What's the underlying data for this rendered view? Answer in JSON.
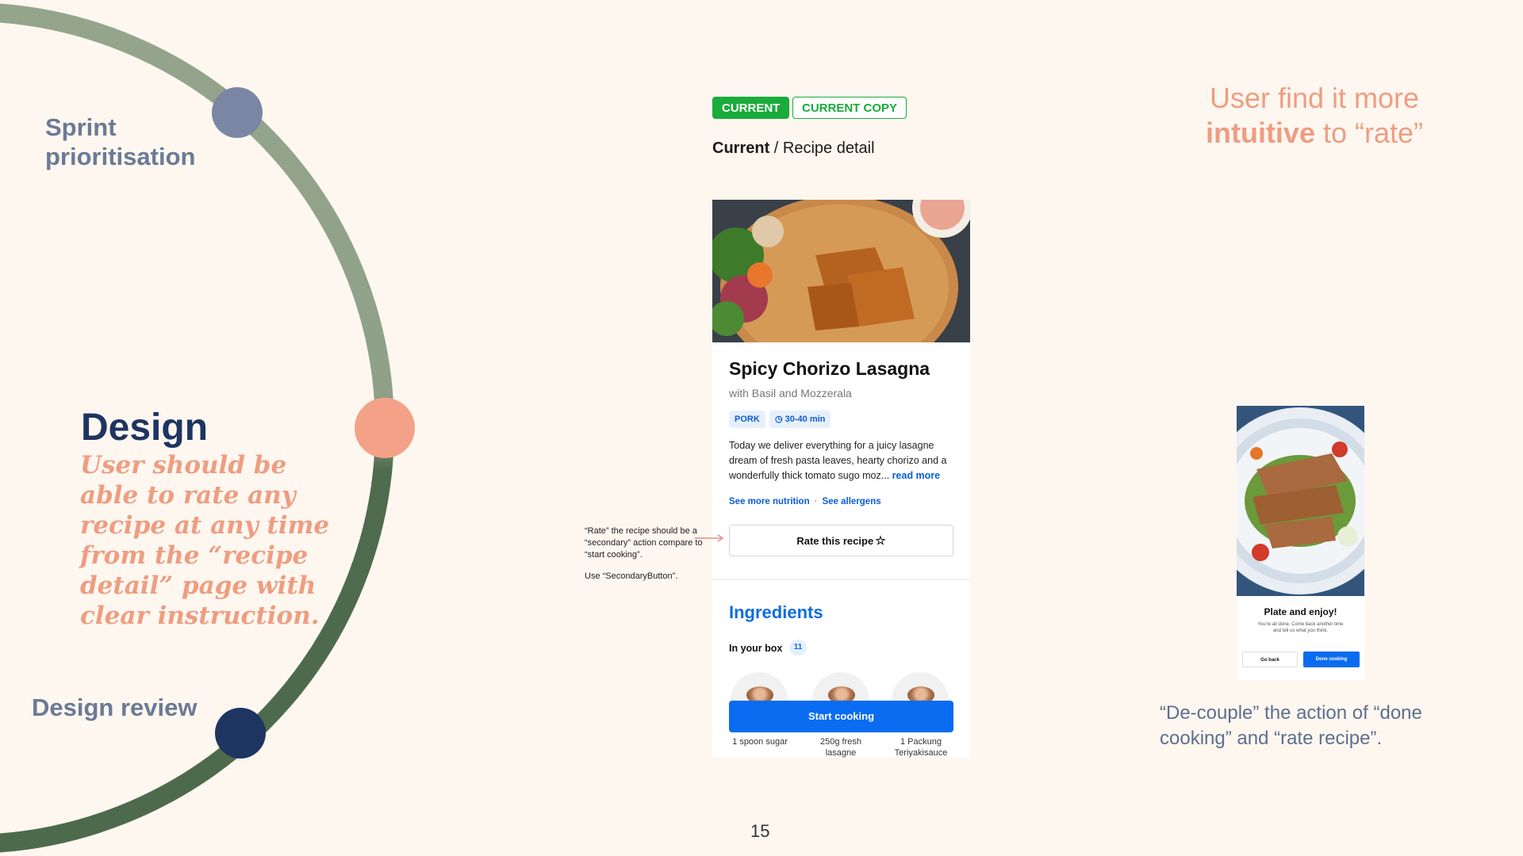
{
  "process": {
    "stages": [
      {
        "label": "Sprint prioritisation"
      },
      {
        "label": "Design"
      },
      {
        "label": "Design review"
      }
    ],
    "design_description": "User should be able to rate any recipe at any time from the “recipe detail” page with clear instruction.",
    "colors": {
      "ring_light": "#94a58c",
      "ring_dark": "#4e6a4c",
      "dot_sprint": "#7a86a3",
      "dot_design": "#f4a287",
      "dot_review": "#1e3461"
    }
  },
  "tags": {
    "current": "CURRENT",
    "current_copy": "CURRENT COPY"
  },
  "breadcrumb": {
    "section": "Current",
    "separator": " / ",
    "page": "Recipe detail"
  },
  "recipe": {
    "title": "Spicy Chorizo Lasagna",
    "subtitle": "with Basil and Mozzerala",
    "chips": {
      "protein": "PORK",
      "time": "30-40 min"
    },
    "description": "Today we deliver everything for a juicy lasagne dream of fresh pasta leaves, hearty chorizo and a wonderfully thick tomato sugo moz...",
    "read_more": "read more",
    "links": {
      "nutrition": "See more nutrition",
      "allergens": "See allergens"
    },
    "rate_button": "Rate this recipe",
    "ingredients_title": "Ingredients",
    "in_your_box": "In your box",
    "in_box_count": "11",
    "ingredients": [
      {
        "name": "1 spoon sugar"
      },
      {
        "name": "250g fresh lasagne"
      },
      {
        "name": "1 Packung Teriyakisauce"
      }
    ],
    "start_button": "Start cooking"
  },
  "annotation": {
    "note": "“Rate” the recipe should be a “secondary” action compare to “start cooking”.",
    "component": "Use “SecondaryButton”."
  },
  "insight": {
    "prefix": "User find it more ",
    "emphasis": "intuitive",
    "suffix": " to “rate”"
  },
  "plate_screen": {
    "title": "Plate and enjoy!",
    "subtitle": "You're all done. Come back another time and tell us what you think.",
    "back_button": "Go back",
    "done_button": "Done cooking"
  },
  "decouple_note": "“De-couple” the action of “done cooking” and “rate recipe”.",
  "page_number": "15"
}
